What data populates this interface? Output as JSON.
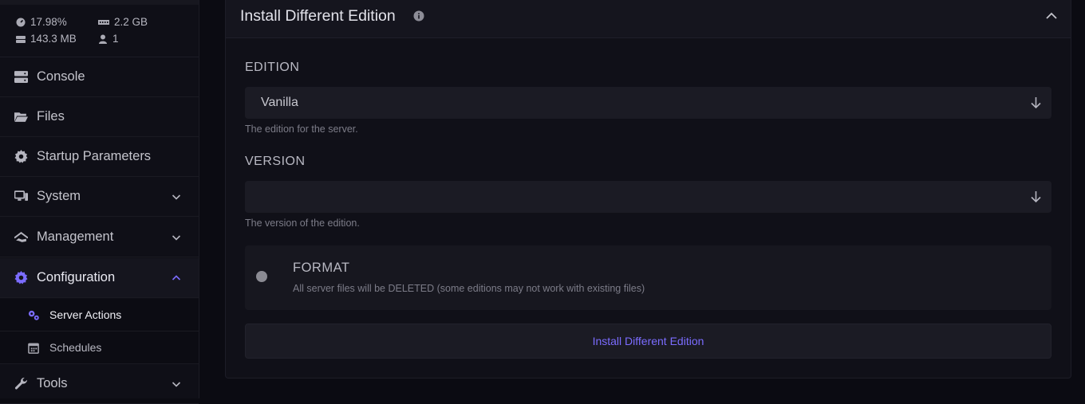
{
  "stats": {
    "cpu": "17.98%",
    "memory": "2.2 GB",
    "disk": "143.3 MB",
    "players": "1"
  },
  "sidebar": {
    "items": [
      {
        "label": "Console",
        "icon": "server-icon"
      },
      {
        "label": "Files",
        "icon": "folder-open-icon"
      },
      {
        "label": "Startup Parameters",
        "icon": "gear-icon"
      },
      {
        "label": "System",
        "icon": "desktop-icon"
      },
      {
        "label": "Management",
        "icon": "tools-hand-icon"
      },
      {
        "label": "Configuration",
        "icon": "gear-icon"
      },
      {
        "label": "Tools",
        "icon": "wrench-icon"
      }
    ],
    "sub_items": [
      {
        "label": "Server Actions",
        "icon": "gears-icon"
      },
      {
        "label": "Schedules",
        "icon": "calendar-icon"
      }
    ]
  },
  "panel": {
    "title": "Install Different Edition",
    "edition_label": "EDITION",
    "edition_value": "Vanilla",
    "edition_help": "The edition for the server.",
    "version_label": "VERSION",
    "version_value": "",
    "version_help": "The version of the edition.",
    "format_title": "FORMAT",
    "format_desc": "All server files will be DELETED (some editions may not work with existing files)",
    "install_button": "Install Different Edition"
  },
  "colors": {
    "accent": "#7b6cff",
    "background": "#0b0b12",
    "panel": "#101018"
  }
}
